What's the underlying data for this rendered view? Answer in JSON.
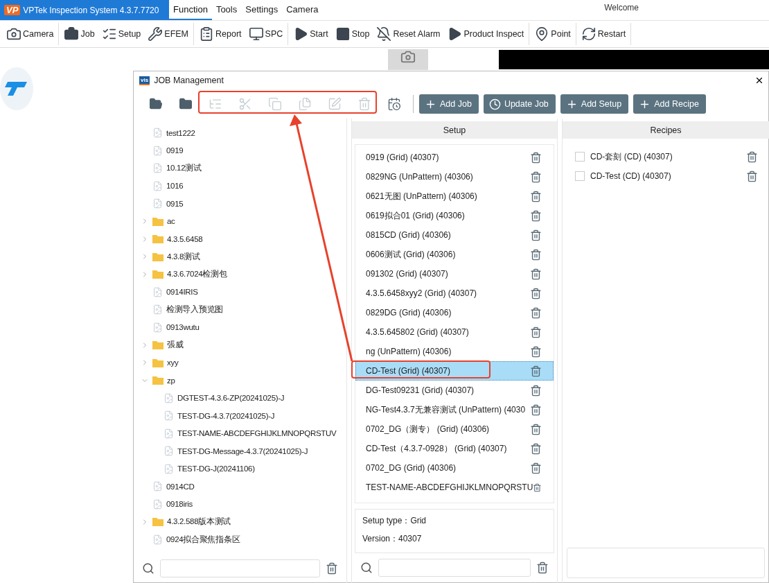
{
  "app": {
    "title": "VPTek Inspection System 4.3.7.7720",
    "logo": "VP",
    "welcome": "Welcome"
  },
  "menu": [
    {
      "label": "Function",
      "selected": true
    },
    {
      "label": "Tools",
      "selected": false
    },
    {
      "label": "Settings",
      "selected": false
    },
    {
      "label": "Camera",
      "selected": false
    }
  ],
  "toolbar": [
    {
      "label": "Camera"
    },
    {
      "label": "Job"
    },
    {
      "label": "Setup"
    },
    {
      "label": "EFEM"
    },
    {
      "label": "Report"
    },
    {
      "label": "SPC"
    },
    {
      "label": "Start"
    },
    {
      "label": "Stop"
    },
    {
      "label": "Reset Alarm"
    },
    {
      "label": "Product Inspect"
    },
    {
      "label": "Point"
    },
    {
      "label": "Restart"
    }
  ],
  "dialog": {
    "badge": "vis",
    "title": "JOB Management",
    "tools": [
      {
        "disabled": false
      },
      {
        "disabled": false
      },
      {
        "disabled": true
      },
      {
        "disabled": true
      },
      {
        "disabled": true
      },
      {
        "disabled": true
      },
      {
        "disabled": true
      },
      {
        "disabled": true
      },
      {
        "disabled": false
      }
    ],
    "buttons": [
      {
        "label": "Add Job"
      },
      {
        "label": "Update Job"
      },
      {
        "label": "Add Setup"
      },
      {
        "label": "Add Recipe"
      }
    ],
    "tree": [
      {
        "label": "test1222",
        "kind": "file"
      },
      {
        "label": "0919",
        "kind": "file"
      },
      {
        "label": "10.12测试",
        "kind": "file"
      },
      {
        "label": "1016",
        "kind": "file"
      },
      {
        "label": "0915",
        "kind": "file"
      },
      {
        "label": "ac",
        "kind": "folder",
        "expanded": false
      },
      {
        "label": "4.3.5.6458",
        "kind": "folder",
        "expanded": false
      },
      {
        "label": "4.3.8测试",
        "kind": "folder",
        "expanded": false
      },
      {
        "label": "4.3.6.7024检测包",
        "kind": "folder",
        "expanded": false
      },
      {
        "label": "0914IRIS",
        "kind": "file"
      },
      {
        "label": "检测导入预览图",
        "kind": "file"
      },
      {
        "label": "0913wutu",
        "kind": "file"
      },
      {
        "label": "張威",
        "kind": "folder",
        "expanded": false
      },
      {
        "label": "xyy",
        "kind": "folder",
        "expanded": false
      },
      {
        "label": "zp",
        "kind": "folder",
        "expanded": true,
        "children": [
          {
            "label": "DGTEST-4.3.6-ZP(20241025)-J",
            "kind": "file"
          },
          {
            "label": "TEST-DG-4.3.7(20241025)-J",
            "kind": "file"
          },
          {
            "label": "TEST-NAME-ABCDEFGHIJKLMNOPQRSTUV",
            "kind": "file"
          },
          {
            "label": "TEST-DG-Message-4.3.7(20241025)-J",
            "kind": "file"
          },
          {
            "label": "TEST-DG-J(20241106)",
            "kind": "file"
          }
        ]
      },
      {
        "label": "0914CD",
        "kind": "file"
      },
      {
        "label": "0918iris",
        "kind": "file"
      },
      {
        "label": "4.3.2.588版本测试",
        "kind": "folder",
        "expanded": false
      },
      {
        "label": "0924拟合聚焦指条区",
        "kind": "file"
      }
    ],
    "setup_header": "Setup",
    "setups": [
      {
        "label": "0919 (Grid) (40307)",
        "selected": false
      },
      {
        "label": "0829NG (UnPattern) (40306)",
        "selected": false
      },
      {
        "label": "0621无图 (UnPattern) (40306)",
        "selected": false
      },
      {
        "label": "0619拟合01 (Grid) (40306)",
        "selected": false
      },
      {
        "label": "0815CD (Grid) (40306)",
        "selected": false
      },
      {
        "label": "0606测试 (Grid) (40306)",
        "selected": false
      },
      {
        "label": "091302 (Grid) (40307)",
        "selected": false
      },
      {
        "label": "4.3.5.6458xyy2 (Grid) (40307)",
        "selected": false
      },
      {
        "label": "0829DG (Grid) (40306)",
        "selected": false
      },
      {
        "label": "4.3.5.645802 (Grid) (40307)",
        "selected": false
      },
      {
        "label": "ng (UnPattern) (40306)",
        "selected": false
      },
      {
        "label": "CD-Test (Grid) (40307)",
        "selected": true
      },
      {
        "label": "DG-Test09231 (Grid) (40307)",
        "selected": false
      },
      {
        "label": "NG-Test4.3.7无兼容测试 (UnPattern) (4030",
        "selected": false
      },
      {
        "label": "0702_DG（测专） (Grid) (40306)",
        "selected": false
      },
      {
        "label": "CD-Test（4.3.7-0928） (Grid) (40307)",
        "selected": false
      },
      {
        "label": "0702_DG (Grid) (40306)",
        "selected": false
      },
      {
        "label": "TEST-NAME-ABCDEFGHIJKLMNOPQRSTU",
        "selected": false
      }
    ],
    "setup_info": [
      "Setup type：Grid",
      "Version：40307"
    ],
    "recipes_header": "Recipes",
    "recipes": [
      {
        "label": "CD-套刻 (CD) (40307)",
        "checked": false
      },
      {
        "label": "CD-Test (CD) (40307)",
        "checked": false
      }
    ]
  }
}
